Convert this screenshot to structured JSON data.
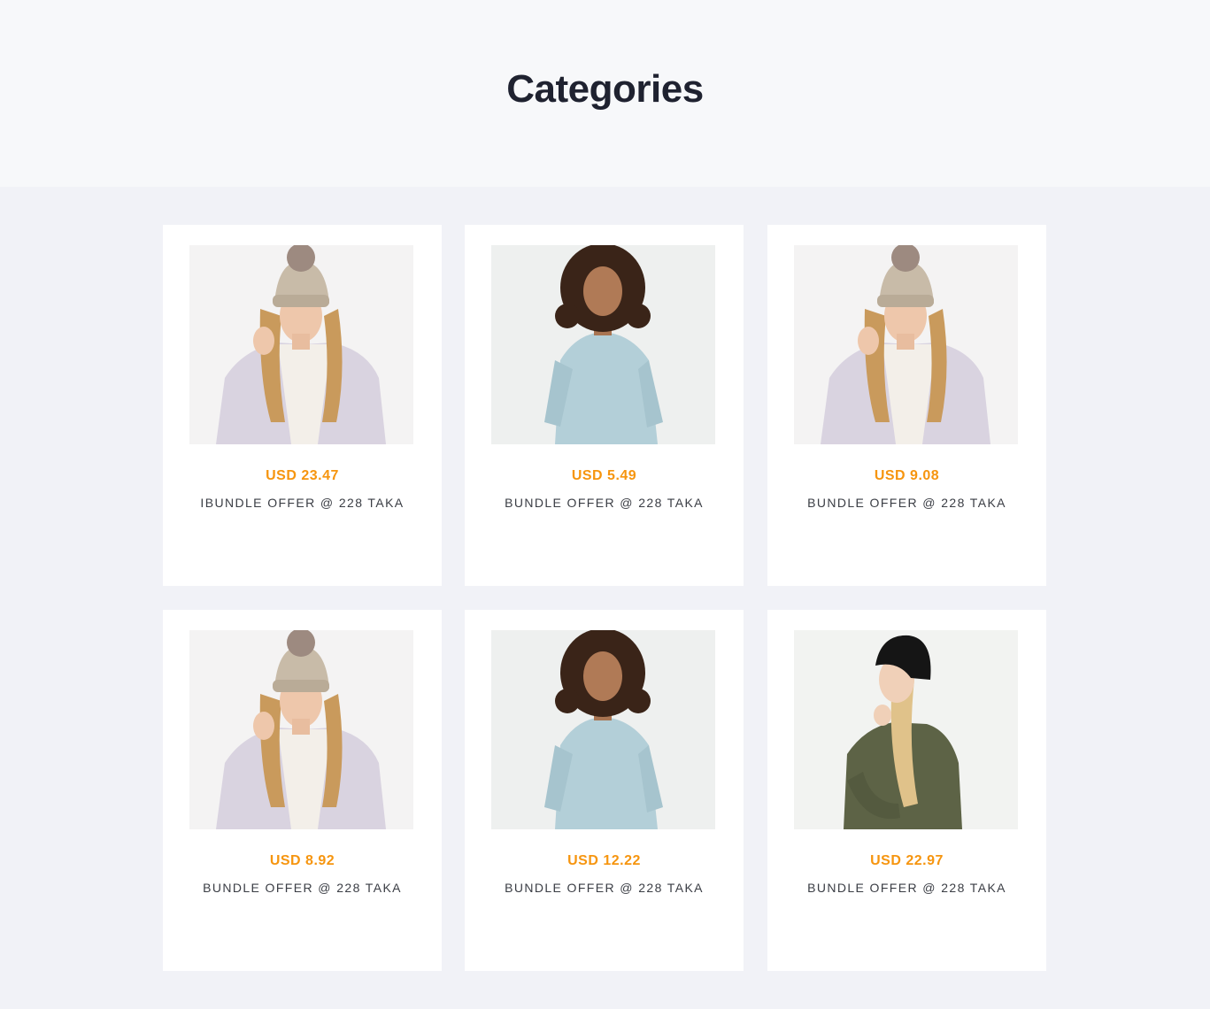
{
  "page": {
    "title": "Categories"
  },
  "products": [
    {
      "price": "USD 23.47",
      "title": "IBUNDLE OFFER @ 228 TAKA",
      "image": "woman-beige-beanie-photo"
    },
    {
      "price": "USD 5.49",
      "title": "BUNDLE OFFER @ 228 TAKA",
      "image": "woman-blue-sweater-photo"
    },
    {
      "price": "USD 9.08",
      "title": "BUNDLE OFFER @ 228 TAKA",
      "image": "woman-beige-beanie-photo"
    },
    {
      "price": "USD 8.92",
      "title": "BUNDLE OFFER @ 228 TAKA",
      "image": "woman-beige-beanie-photo"
    },
    {
      "price": "USD 12.22",
      "title": "BUNDLE OFFER @ 228 TAKA",
      "image": "woman-blue-sweater-photo"
    },
    {
      "price": "USD 22.97",
      "title": "BUNDLE OFFER @ 228 TAKA",
      "image": "woman-black-beanie-photo"
    }
  ],
  "colors": {
    "price": "#f6950f",
    "title": "#3a3d44",
    "heading": "#1f2230",
    "card": "#ffffff",
    "section_bg": "#f1f2f7",
    "header_bg": "#f7f8fa"
  }
}
